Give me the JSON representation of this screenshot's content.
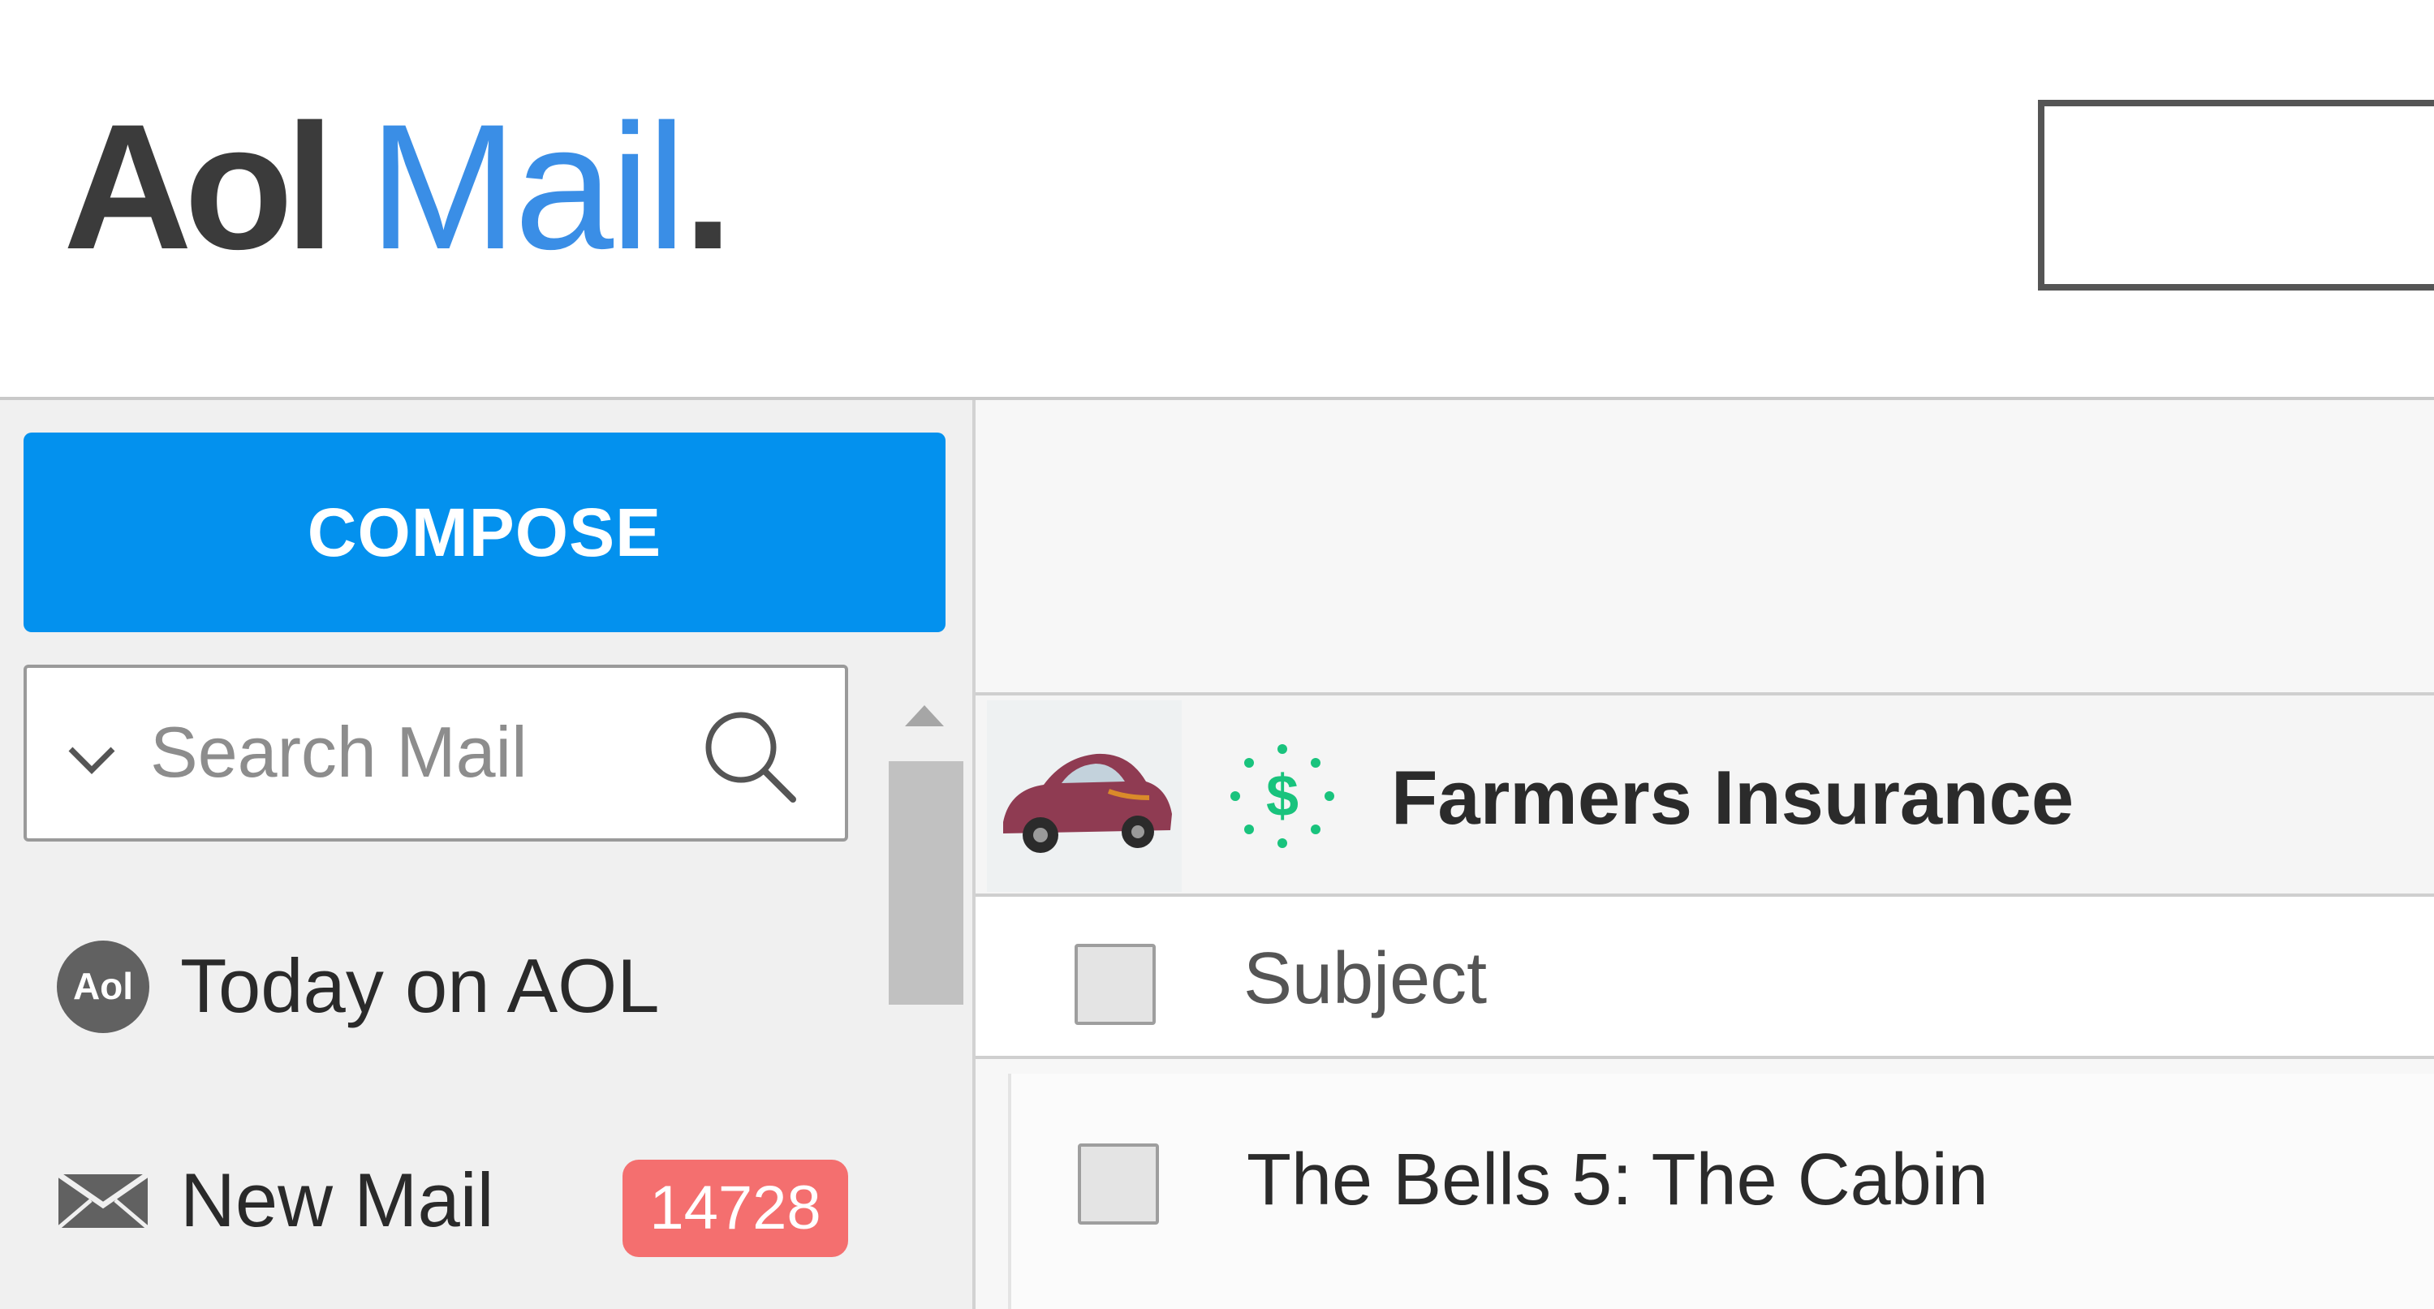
{
  "header": {
    "logo": {
      "aol": "Aol",
      "mail": "Mail",
      "dot": "."
    }
  },
  "sidebar": {
    "compose_label": "COMPOSE",
    "search": {
      "placeholder": "Search Mail",
      "value": ""
    },
    "nav": [
      {
        "label": "Today on AOL",
        "icon": "aol-logo-icon"
      },
      {
        "label": "New Mail",
        "icon": "envelope-icon",
        "badge": "14728"
      }
    ]
  },
  "message_list": {
    "ad": {
      "sender": "Farmers Insurance",
      "thumbnail_icon": "car-icon",
      "sponsor_icon": "dollar-sponsored-icon"
    },
    "columns": {
      "subject": "Subject"
    },
    "rows": [
      {
        "subject": "The Bells 5: The Cabin"
      }
    ]
  },
  "colors": {
    "compose_blue": "#0391ee",
    "logo_blue": "#3a8ee6",
    "badge_red": "#f46f6f",
    "sponsor_green": "#19c37d"
  }
}
